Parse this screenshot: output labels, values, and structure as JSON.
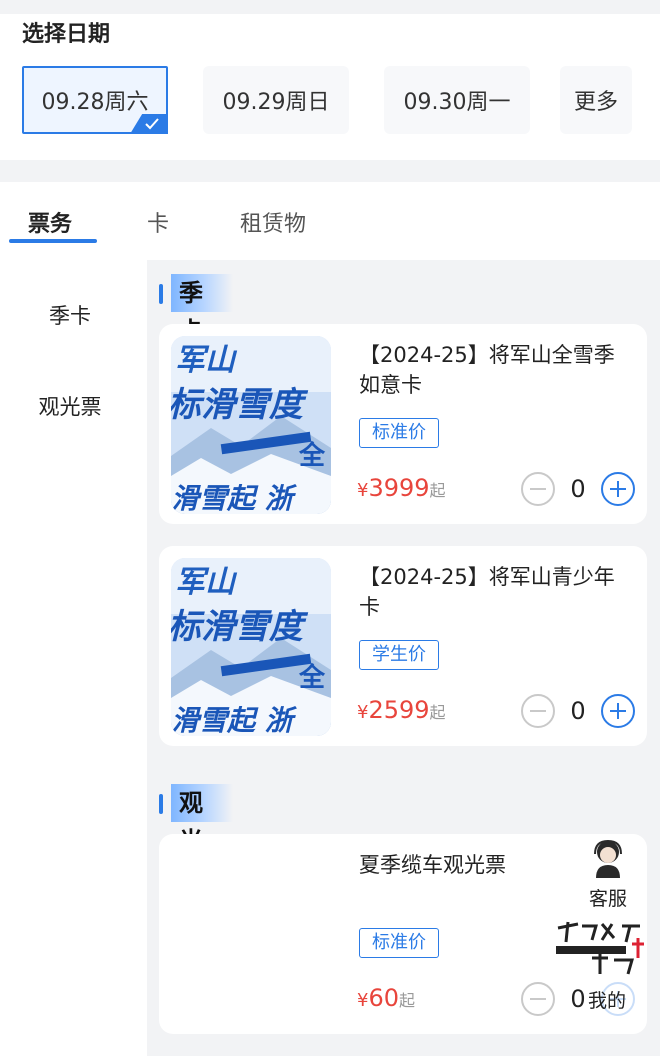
{
  "date_section": {
    "title": "选择日期",
    "dates": [
      {
        "label": "09.28周六",
        "selected": true
      },
      {
        "label": "09.29周日",
        "selected": false
      },
      {
        "label": "09.30周一",
        "selected": false
      }
    ],
    "more_label": "更多"
  },
  "tabs": [
    "票务",
    "卡",
    "租赁物"
  ],
  "active_tab": "票务",
  "sidebar": [
    "季卡",
    "观光票"
  ],
  "sections": [
    {
      "title": "季卡",
      "items": [
        {
          "name": "【2024-25】将军山全雪季如意卡",
          "tag": "标准价",
          "currency": "¥",
          "price": "3999",
          "price_suffix": "起",
          "count": "0"
        },
        {
          "name": "【2024-25】将军山青少年卡",
          "tag": "学生价",
          "currency": "¥",
          "price": "2599",
          "price_suffix": "起",
          "count": "0"
        }
      ]
    },
    {
      "title": "观光票",
      "items": [
        {
          "name": "夏季缆车观光票",
          "tag": "标准价",
          "currency": "¥",
          "price": "60",
          "price_suffix": "起",
          "count": "0"
        }
      ]
    }
  ],
  "floating": {
    "customer_service": "客服",
    "mine": "我的"
  },
  "colors": {
    "accent": "#2b7be6",
    "price": "#e8453c"
  }
}
